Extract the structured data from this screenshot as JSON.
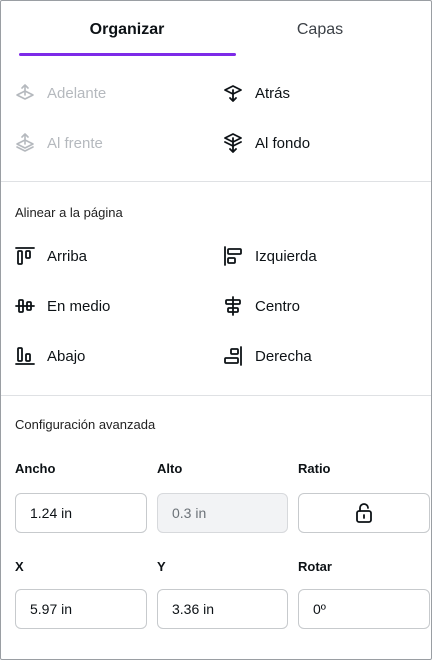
{
  "tabs": [
    {
      "label": "Organizar",
      "active": true
    },
    {
      "label": "Capas",
      "active": false
    }
  ],
  "order": {
    "forward": {
      "label": "Adelante",
      "enabled": false,
      "icon": "bring-forward-icon"
    },
    "backward": {
      "label": "Atrás",
      "enabled": true,
      "icon": "send-backward-icon"
    },
    "to_front": {
      "label": "Al frente",
      "enabled": false,
      "icon": "bring-to-front-icon"
    },
    "to_back": {
      "label": "Al fondo",
      "enabled": true,
      "icon": "send-to-back-icon"
    }
  },
  "align": {
    "title": "Alinear a la página",
    "top": {
      "label": "Arriba",
      "icon": "align-top-icon"
    },
    "left": {
      "label": "Izquierda",
      "icon": "align-left-icon"
    },
    "middle": {
      "label": "En medio",
      "icon": "align-middle-icon"
    },
    "center": {
      "label": "Centro",
      "icon": "align-center-icon"
    },
    "bottom": {
      "label": "Abajo",
      "icon": "align-bottom-icon"
    },
    "right": {
      "label": "Derecha",
      "icon": "align-right-icon"
    }
  },
  "advanced": {
    "title": "Configuración avanzada",
    "width": {
      "label": "Ancho",
      "value": "1.24 in"
    },
    "height": {
      "label": "Alto",
      "value": "0.3 in"
    },
    "ratio": {
      "label": "Ratio",
      "icon": "unlocked-padlock-icon"
    },
    "x": {
      "label": "X",
      "value": "5.97 in"
    },
    "y": {
      "label": "Y",
      "value": "3.36 in"
    },
    "rotate": {
      "label": "Rotar",
      "value": "0º"
    }
  },
  "colors": {
    "accent": "#7d2ae8",
    "disabled": "#b5b9be",
    "text": "#0d1216"
  }
}
